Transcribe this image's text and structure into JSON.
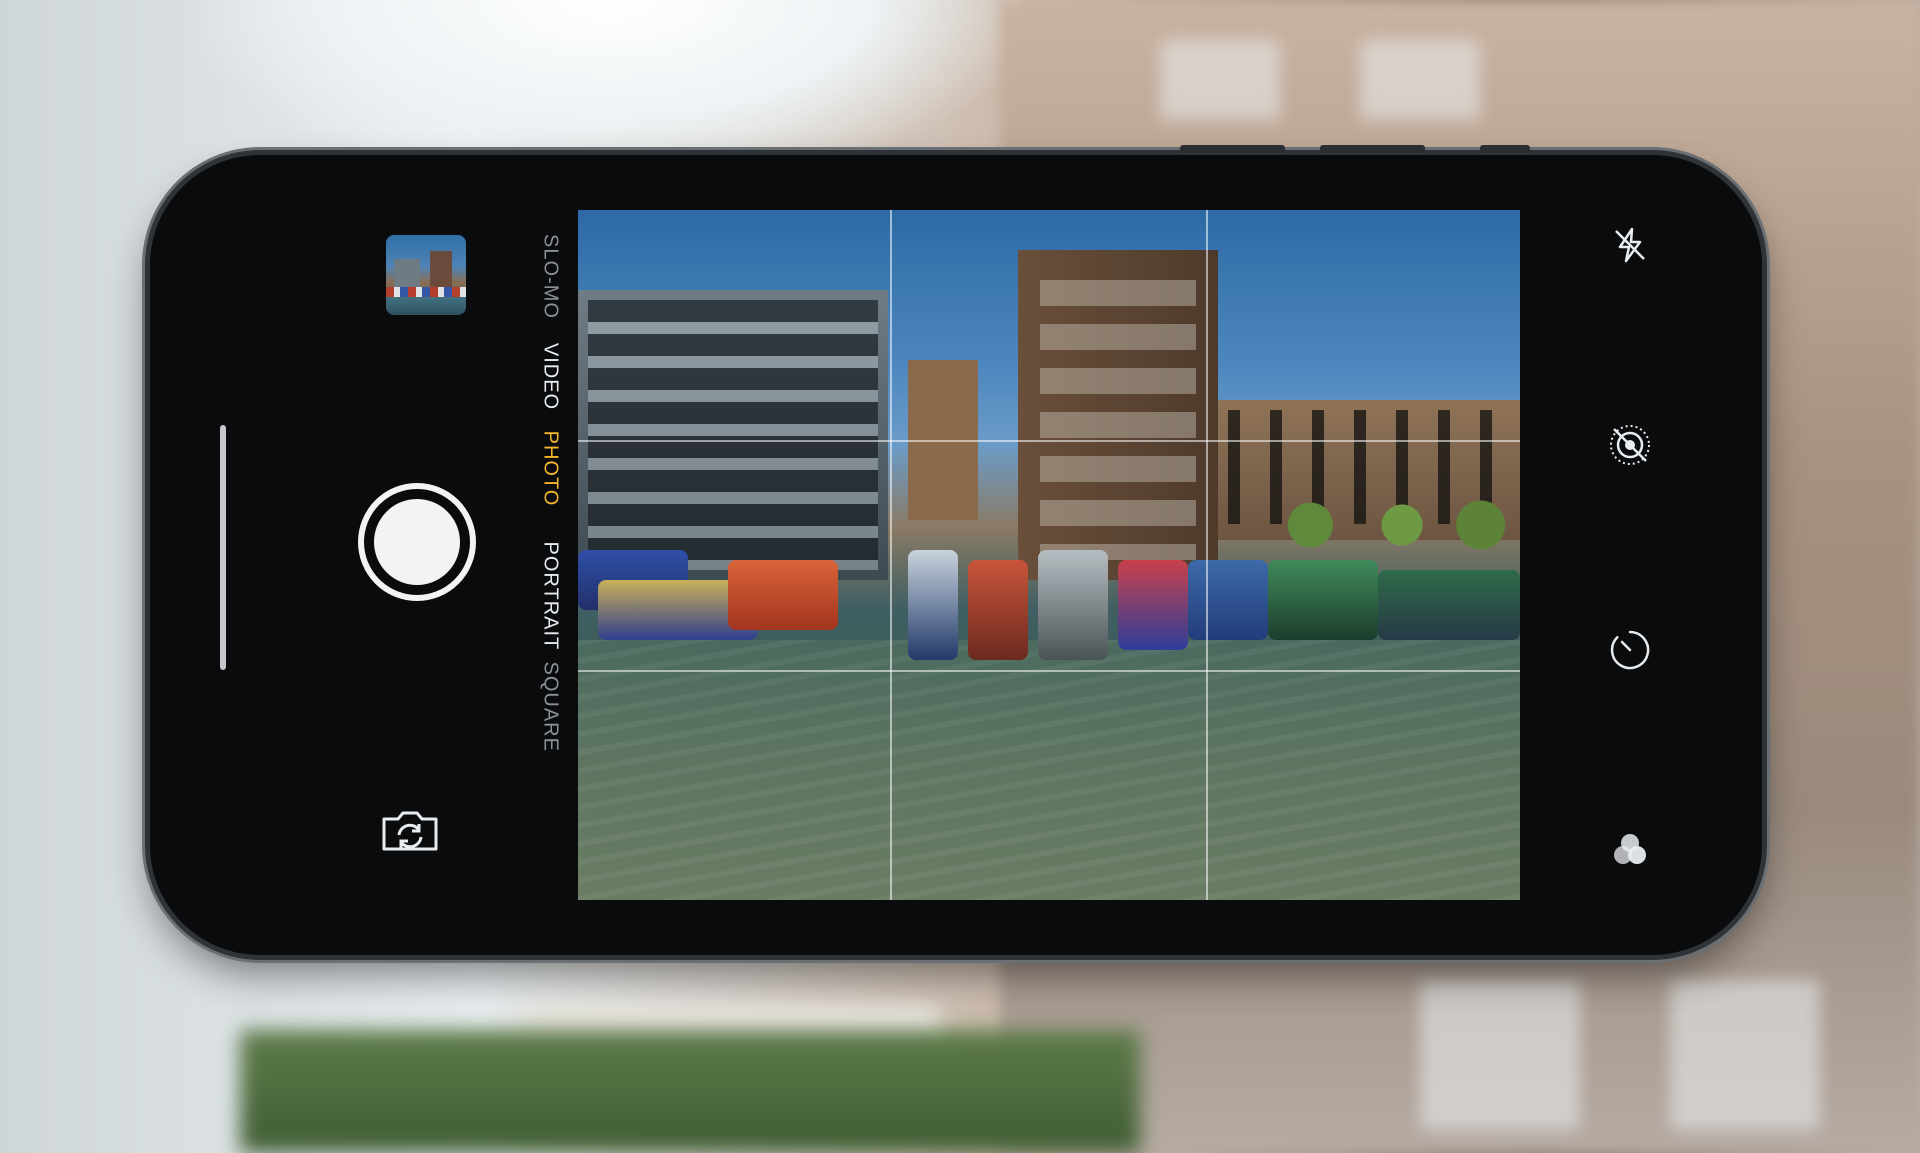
{
  "camera": {
    "modes": [
      "SLO-MO",
      "VIDEO",
      "PHOTO",
      "PORTRAIT",
      "SQUARE"
    ],
    "active_mode": "PHOTO",
    "colors": {
      "active_mode": "#f4b52b",
      "mode_text": "#e9ecef",
      "shutter": "#f3f3f3",
      "phone_body": "#0a0b0d"
    }
  },
  "icons": {
    "flash": "flash-off-icon",
    "live_photo": "live-photo-off-icon",
    "timer": "timer-icon",
    "filters": "filters-icon",
    "switch_camera": "switch-camera-icon",
    "last_photo": "photo-thumbnail"
  }
}
